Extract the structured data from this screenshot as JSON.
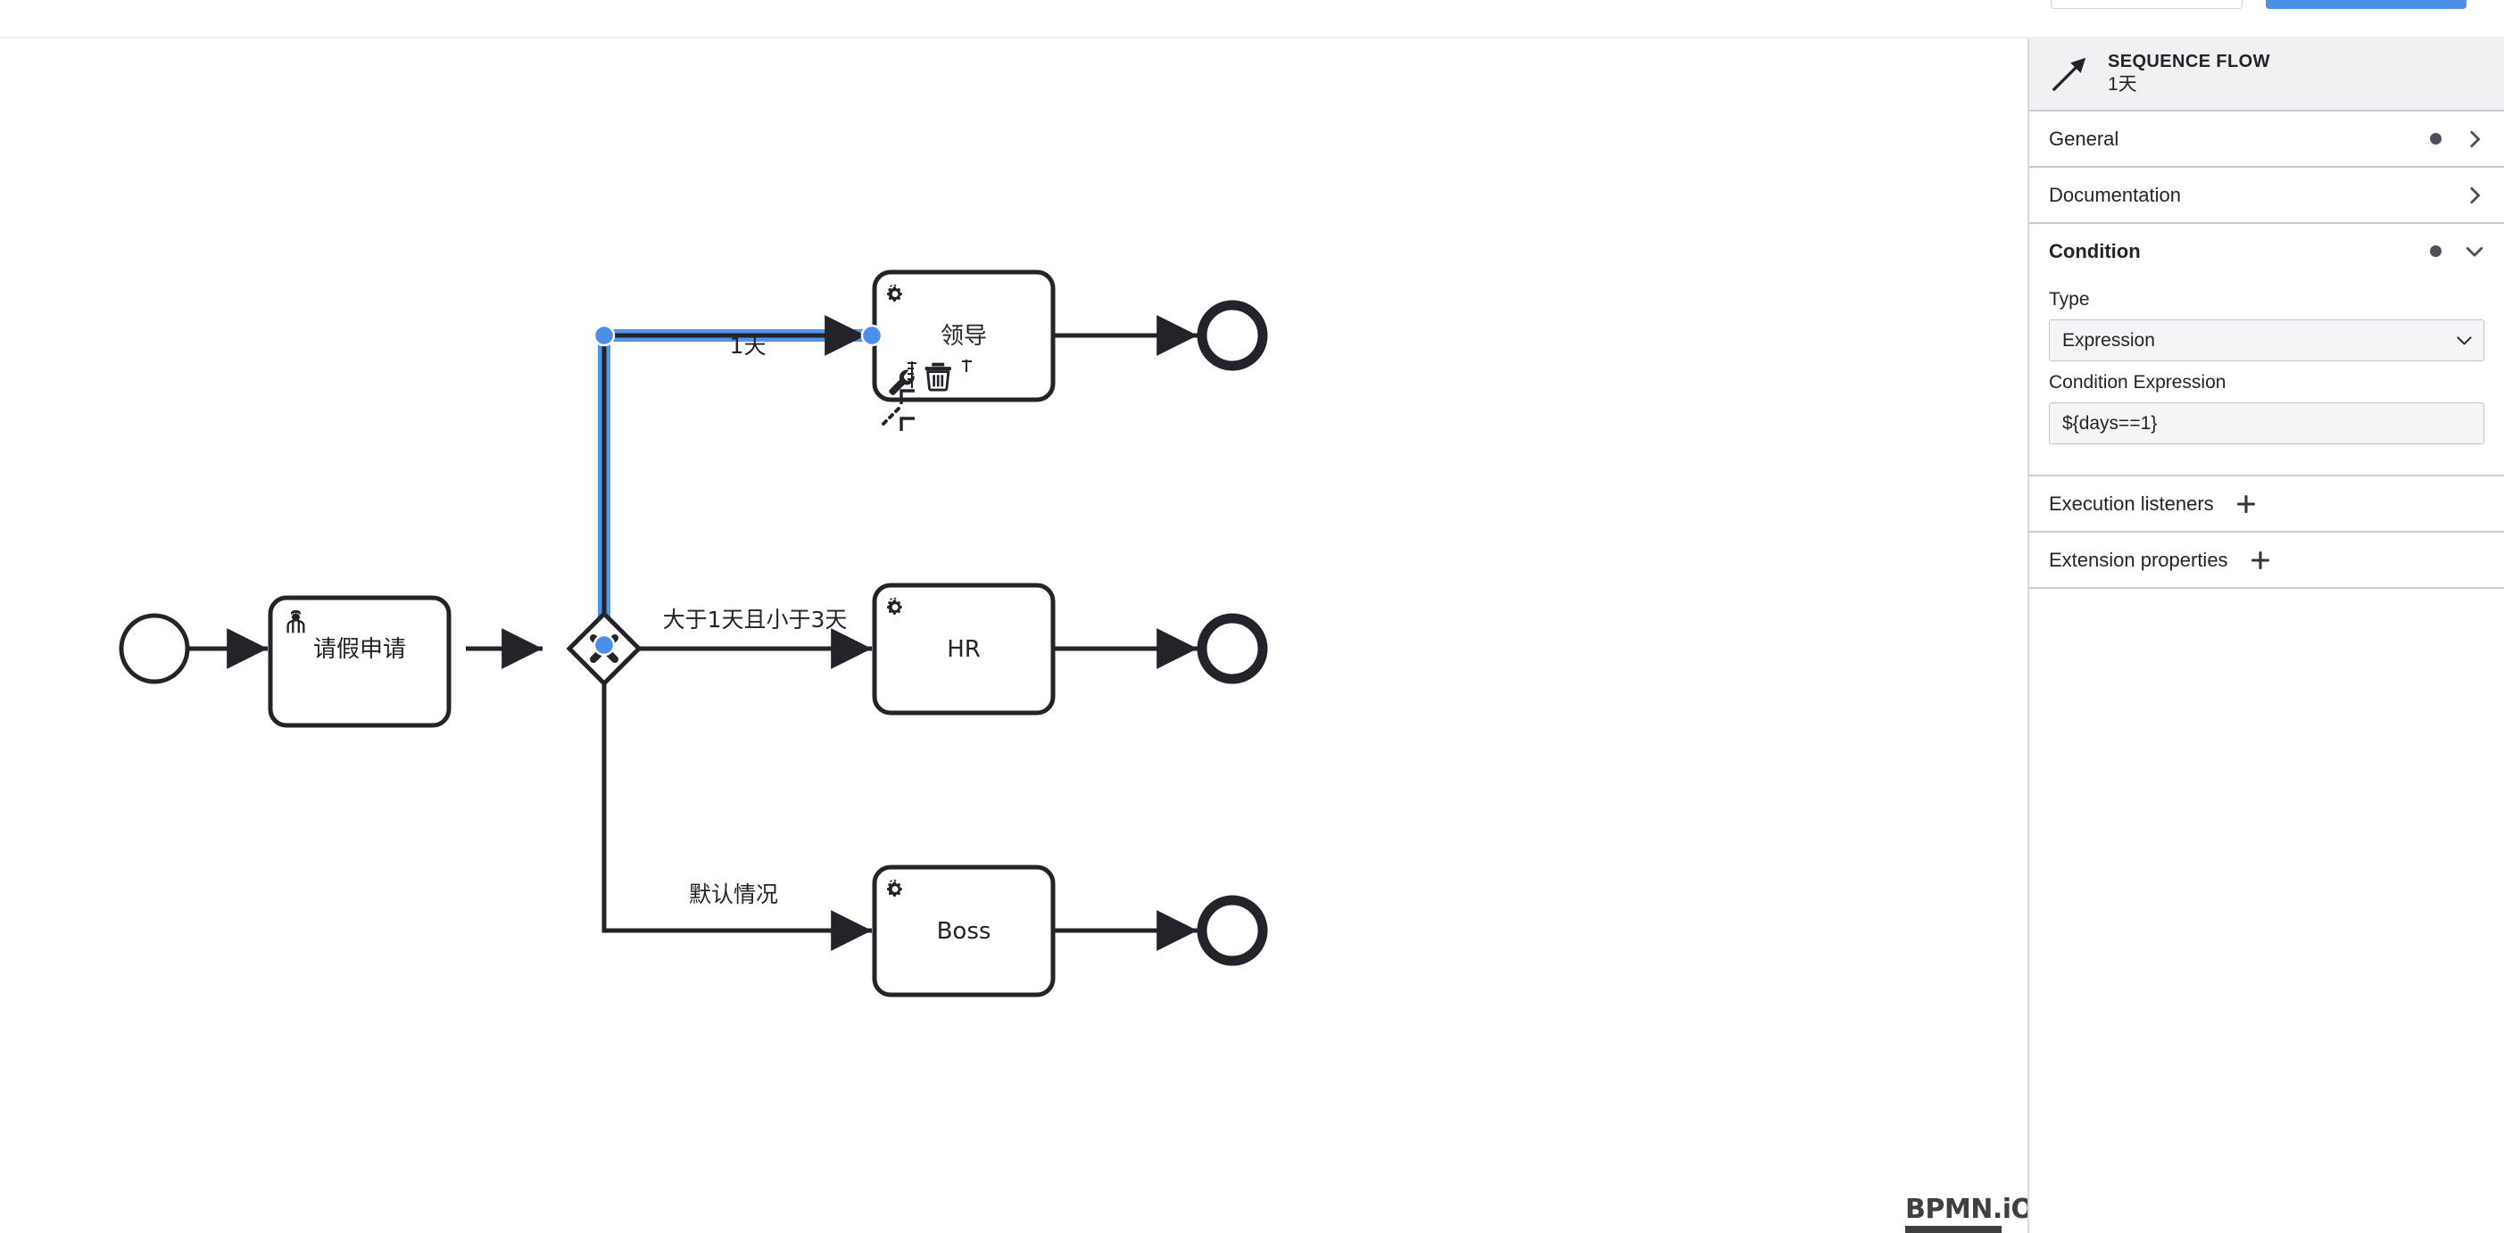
{
  "topbar": {
    "secondary_button_label": "",
    "primary_button_label": ""
  },
  "canvas": {
    "logo_text": "BPMN.iO",
    "nodes": [
      {
        "id": "start",
        "type": "start-event",
        "label": ""
      },
      {
        "id": "task-apply",
        "type": "user-task",
        "label": "请假申请"
      },
      {
        "id": "gateway",
        "type": "exclusive-gateway",
        "label": "",
        "marker": "X"
      },
      {
        "id": "task-leader",
        "type": "service-task",
        "label": "领导"
      },
      {
        "id": "task-hr",
        "type": "service-task",
        "label": "HR"
      },
      {
        "id": "task-boss",
        "type": "service-task",
        "label": "Boss"
      },
      {
        "id": "end-1",
        "type": "end-event",
        "label": ""
      },
      {
        "id": "end-2",
        "type": "end-event",
        "label": ""
      },
      {
        "id": "end-3",
        "type": "end-event",
        "label": ""
      }
    ],
    "flows": [
      {
        "id": "flow-1天",
        "label": "1天",
        "selected": true
      },
      {
        "id": "flow-mid",
        "label": "大于1天且小于3天",
        "selected": false
      },
      {
        "id": "flow-default",
        "label": "默认情况",
        "selected": false
      }
    ],
    "context_pad": {
      "items": [
        {
          "name": "wrench-icon",
          "title": "wrench"
        },
        {
          "name": "trash-icon",
          "title": "delete"
        },
        {
          "name": "connect-icon",
          "title": "connect"
        }
      ]
    },
    "selection_color": "#4a90e8"
  },
  "panel": {
    "header": {
      "element_type": "SEQUENCE FLOW",
      "element_name": "1天",
      "icon": "sequence-flow-icon"
    },
    "groups": [
      {
        "id": "general",
        "title": "General",
        "has_dot": true,
        "open": false
      },
      {
        "id": "documentation",
        "title": "Documentation",
        "has_dot": false,
        "open": false
      },
      {
        "id": "condition",
        "title": "Condition",
        "has_dot": true,
        "open": true,
        "fields": [
          {
            "id": "type",
            "label": "Type",
            "control": "select",
            "value": "Expression",
            "options": [
              "Expression"
            ]
          },
          {
            "id": "condition-expression",
            "label": "Condition Expression",
            "control": "input",
            "value": "${days==1}",
            "placeholder": ""
          }
        ]
      },
      {
        "id": "execution-listeners",
        "title": "Execution listeners",
        "has_add": true,
        "open": false
      },
      {
        "id": "extension-properties",
        "title": "Extension properties",
        "has_add": true,
        "open": false
      }
    ]
  }
}
